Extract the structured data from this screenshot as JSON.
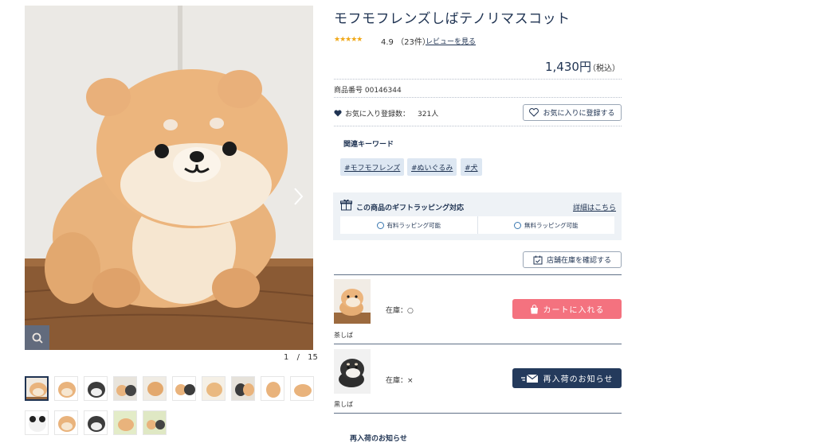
{
  "gallery": {
    "counter_current": "1",
    "counter_sep": "/",
    "counter_total": "15"
  },
  "product": {
    "title": "モフモフレンズしばテノリマスコット",
    "stars": "★★★★★",
    "rating": "4.9",
    "review_count": "（23件）",
    "review_link": "レビューを見る",
    "price": "1,430円",
    "tax_note": "（税込）",
    "product_no": "商品番号 00146344"
  },
  "favorite": {
    "count_label": "お気に入り登録数：",
    "count_value": "321人",
    "button_label": "お気に入りに登録する"
  },
  "keywords": {
    "heading": "関連キーワード",
    "tags": [
      "#モフモフレンズ",
      "#ぬいぐるみ",
      "#犬"
    ]
  },
  "gift": {
    "title": "この商品のギフトラッピング対応",
    "detail_link": "詳細はこちら",
    "options": [
      "有料ラッピング可能",
      "無料ラッピング可能"
    ]
  },
  "store_stock_button": "店舗在庫を確認する",
  "variants": [
    {
      "name": "茶しば",
      "stock": "在庫：○",
      "action": "カートに入れる"
    },
    {
      "name": "黒しば",
      "stock": "在庫：×",
      "action": "再入荷のお知らせ"
    }
  ],
  "restock_heading": "再入荷のお知らせ",
  "colors": {
    "navy": "#1f3352",
    "cart_pink": "#f4727f",
    "restock_navy": "#243a5c",
    "tag_bg": "#dde7f2",
    "star": "#f0a818"
  }
}
